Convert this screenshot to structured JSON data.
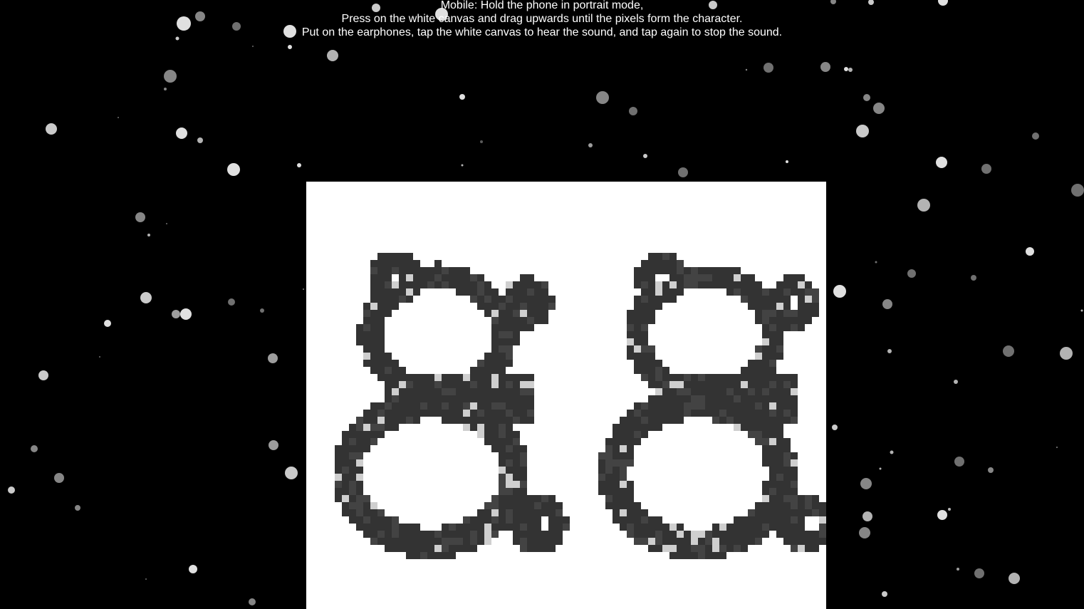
{
  "instructions": {
    "line1": "Mobile: Hold the phone in portrait mode,",
    "line2": "Press on the white canvas and drag upwards until the pixels form the character.",
    "line3": "Put on the earphones, tap the white canvas to hear the sound, and tap again to stop the sound."
  },
  "canvas": {
    "characters": [
      "8",
      "8"
    ],
    "background_color": "#ffffff",
    "pixel_color": "#333333",
    "pixel_highlight_color": "#cfcfcf"
  },
  "background": {
    "color": "#000000",
    "particle_color": "#e0e0e0"
  }
}
